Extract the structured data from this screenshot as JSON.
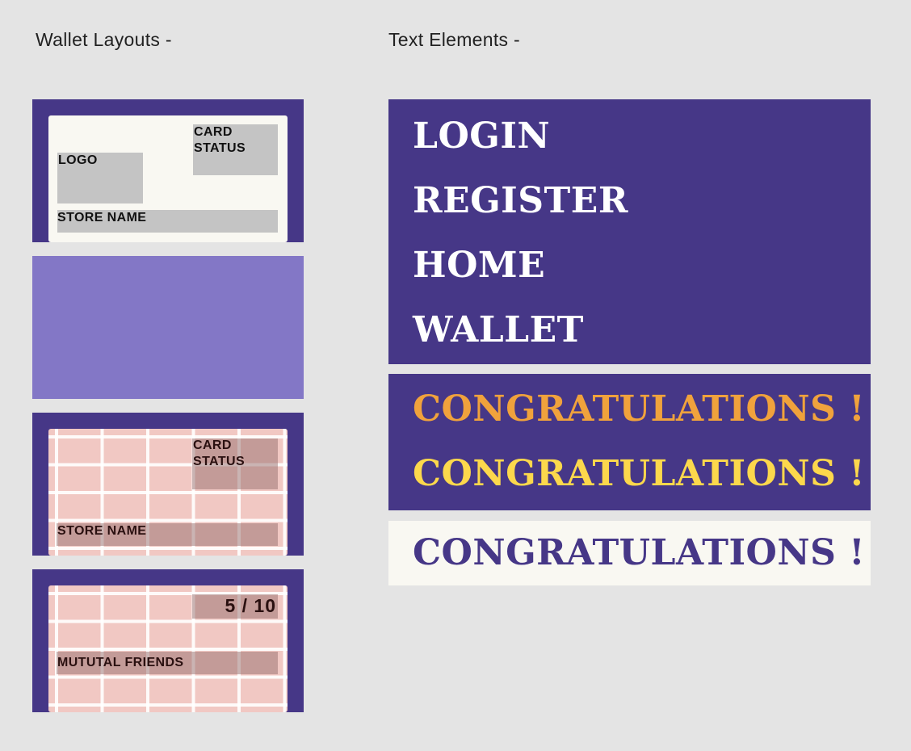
{
  "headings": {
    "wallet_layouts": "Wallet Layouts -",
    "text_elements": "Text Elements -"
  },
  "wallet_cards": {
    "card1": {
      "logo": "LOGO",
      "card_status": "CARD\nSTATUS",
      "store_name": "STORE NAME"
    },
    "card3": {
      "card_status": "CARD\nSTATUS",
      "store_name": "STORE NAME"
    },
    "card4": {
      "count": "5 / 10",
      "mutual_friends": "MUTUTAL FRIENDS"
    }
  },
  "text_elements": {
    "nav": [
      "LOGIN",
      "REGISTER",
      "HOME",
      "WALLET"
    ],
    "congrats": "CONGRATULATIONS !"
  },
  "colors": {
    "background": "#e4e4e4",
    "purple_dark": "#463787",
    "purple_light": "#8377c6",
    "cream": "#f9f8f2",
    "placeholder_gray": "#c4c4c4",
    "pink_grid": "#f1c8c3",
    "congrats_orange": "#f0a23c",
    "congrats_yellow": "#fcd84c",
    "congrats_purple": "#463787",
    "nav_text": "#ffffff"
  }
}
